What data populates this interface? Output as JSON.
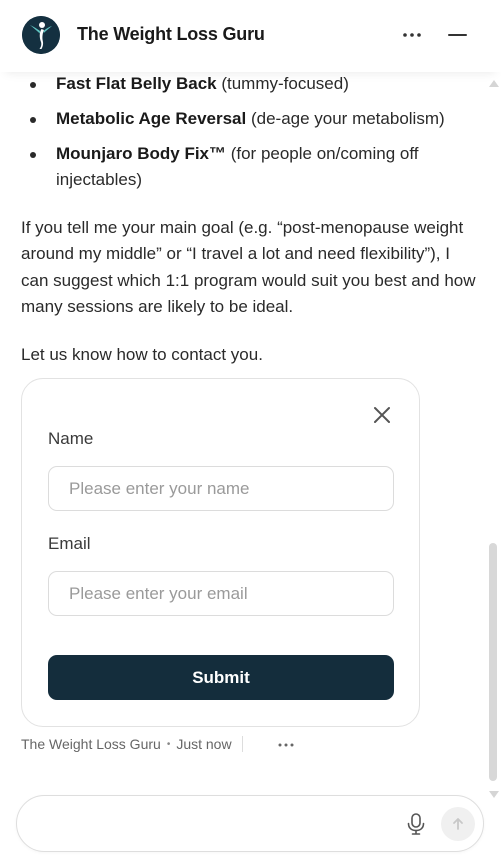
{
  "header": {
    "title": "The Weight Loss Guru",
    "logo_icon": "guru-figure-logo",
    "more_icon": "more-horizontal-icon",
    "minimize_icon": "minimize-icon"
  },
  "programs": [
    {
      "name": "Fast Flat Belly Back",
      "desc": " (tummy-focused)"
    },
    {
      "name": "Metabolic Age Reversal",
      "desc": " (de-age your metabolism)"
    },
    {
      "name": "Mounjaro Body Fix™",
      "desc": " (for people on/coming off injectables)"
    }
  ],
  "message": {
    "paragraph": "If you tell me your main goal (e.g. “post-menopause weight around my middle” or “I travel a lot and need flexibility”), I can suggest which 1:1 program would suit you best and how many sessions are likely to be ideal.",
    "contact_prompt": "Let us know how to contact you."
  },
  "form": {
    "name_label": "Name",
    "name_placeholder": "Please enter your name",
    "email_label": "Email",
    "email_placeholder": "Please enter your email",
    "submit_label": "Submit",
    "close_icon": "close-icon"
  },
  "meta": {
    "sender": "The Weight Loss Guru",
    "separator": "•",
    "time": "Just now"
  },
  "composer": {
    "placeholder": "",
    "mic_icon": "microphone-icon",
    "send_icon": "send-arrow-icon"
  },
  "colors": {
    "brand_dark": "#142d3c",
    "text": "#2a2a2a",
    "border": "#e2e2e2"
  }
}
